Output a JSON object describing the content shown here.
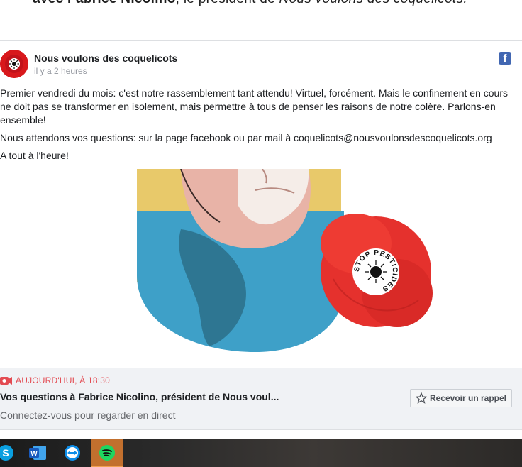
{
  "article": {
    "intro_bold": "avec Fabrice Nicolino",
    "intro_mid": ", le président de ",
    "intro_italic": "Nous voulons des coquelicots."
  },
  "post": {
    "page_name": "Nous voulons des coquelicots",
    "timestamp": "il y a 2 heures",
    "paragraphs": [
      "Premier vendredi du mois: c'est notre rassemblement tant attendu! Virtuel, forcément. Mais le confinement en cours ne doit pas se transformer en isolement, mais permettre à tous de penser les raisons de notre colère. Parlons-en ensemble!",
      "Nous attendons vos questions: sur la page facebook ou par mail à coquelicots@nousvoulonsdescoquelicots.org",
      "A tout à l'heure!"
    ],
    "image": {
      "stamp_text": "STOP PESTICIDES"
    }
  },
  "live": {
    "when": "AUJOURD'HUI, À 18:30",
    "title": "Vos questions à Fabrice Nicolino, président de Nous voul...",
    "subtitle": "Connectez-vous pour regarder en direct",
    "remind_label": "Recevoir un rappel"
  },
  "taskbar": {
    "apps": [
      "skype-icon",
      "word-icon",
      "teamviewer-icon",
      "spotify-icon"
    ],
    "active": "spotify-icon"
  },
  "colors": {
    "facebook_blue": "#4267b2",
    "live_red": "#e34b52",
    "poppy_red": "#e5312d",
    "poster_yellow": "#e8c96a",
    "poster_blue": "#3ea0c8"
  }
}
